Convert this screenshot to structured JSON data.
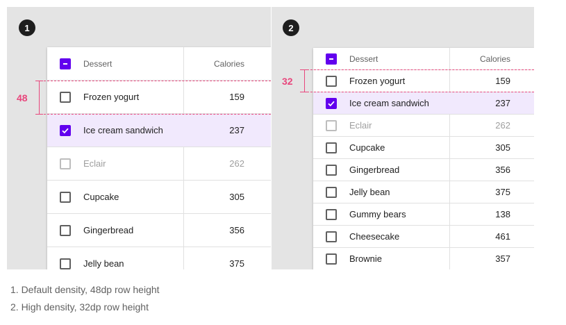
{
  "panels": [
    {
      "marker": "1",
      "headers": {
        "dessert": "Dessert",
        "calories": "Calories"
      },
      "measure_label": "48",
      "rows": [
        {
          "name": "Frozen yogurt",
          "calories": "159",
          "state": "unchecked"
        },
        {
          "name": "Ice cream sandwich",
          "calories": "237",
          "state": "checked"
        },
        {
          "name": "Eclair",
          "calories": "262",
          "state": "disabled"
        },
        {
          "name": "Cupcake",
          "calories": "305",
          "state": "unchecked"
        },
        {
          "name": "Gingerbread",
          "calories": "356",
          "state": "unchecked"
        },
        {
          "name": "Jelly bean",
          "calories": "375",
          "state": "unchecked"
        }
      ]
    },
    {
      "marker": "2",
      "headers": {
        "dessert": "Dessert",
        "calories": "Calories"
      },
      "measure_label": "32",
      "rows": [
        {
          "name": "Frozen yogurt",
          "calories": "159",
          "state": "unchecked"
        },
        {
          "name": "Ice cream sandwich",
          "calories": "237",
          "state": "checked"
        },
        {
          "name": "Eclair",
          "calories": "262",
          "state": "disabled"
        },
        {
          "name": "Cupcake",
          "calories": "305",
          "state": "unchecked"
        },
        {
          "name": "Gingerbread",
          "calories": "356",
          "state": "unchecked"
        },
        {
          "name": "Jelly bean",
          "calories": "375",
          "state": "unchecked"
        },
        {
          "name": "Gummy bears",
          "calories": "138",
          "state": "unchecked"
        },
        {
          "name": "Cheesecake",
          "calories": "461",
          "state": "unchecked"
        },
        {
          "name": "Brownie",
          "calories": "357",
          "state": "unchecked"
        }
      ]
    }
  ],
  "captions": [
    "1. Default density, 48dp row height",
    "2. High density, 32dp row height"
  ],
  "colors": {
    "accent": "#6200ee",
    "selected_row": "#f1e9fd",
    "measure": "#e8467c"
  }
}
